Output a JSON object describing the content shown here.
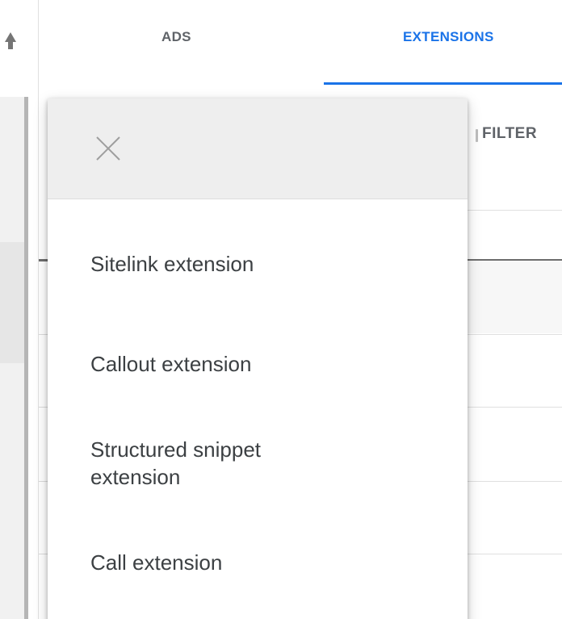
{
  "tabs": {
    "ads": "ADS",
    "extensions": "EXTENSIONS",
    "active": "EXTENSIONS"
  },
  "toolbar": {
    "filter_label": "FILTER"
  },
  "menu": {
    "close_icon": "close-icon",
    "items": [
      {
        "label": "Sitelink extension"
      },
      {
        "label": "Callout extension"
      },
      {
        "label": "Structured snippet extension"
      },
      {
        "label": "Call extension"
      }
    ]
  },
  "colors": {
    "accent": "#1a73e8",
    "tab_inactive": "#5f6368",
    "menu_text": "#3c4043",
    "menu_header_bg": "#eeeeee"
  }
}
